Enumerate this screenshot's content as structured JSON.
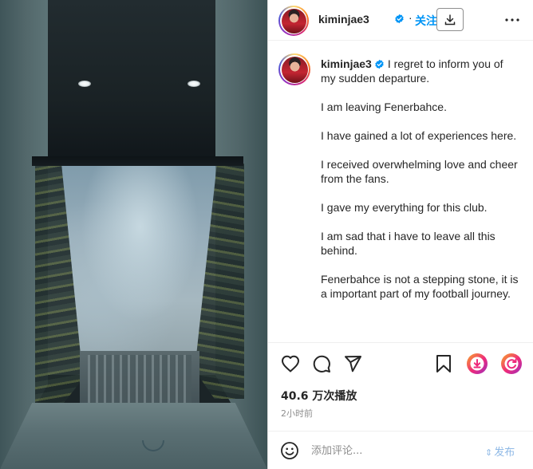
{
  "colors": {
    "accent": "#0095f6",
    "text": "#262626",
    "secondary_text": "#8e8e8e",
    "post_disabled": "#8fb9e6"
  },
  "header": {
    "username": "kiminjae3",
    "verified_icon": "verified-badge-icon",
    "separator": "·",
    "follow_label": "关注",
    "download_icon": "download-icon",
    "more_icon": "more-options-icon"
  },
  "caption": {
    "username": "kiminjae3",
    "paragraphs": [
      "I regret to inform you of my sudden departure.",
      "I am leaving Fenerbahce.",
      "I have gained a lot of experiences here.",
      "I received overwhelming love and cheer from the fans.",
      "I gave my everything for this club.",
      "I am sad that i have to leave all this behind.",
      "Fenerbahce is not a stepping stone, it is a important part of my football journey."
    ]
  },
  "actions": {
    "like_icon": "heart-icon",
    "comment_icon": "comment-icon",
    "share_icon": "share-icon",
    "save_icon": "bookmark-icon",
    "ext_download_icon": "download-extension-icon",
    "ext_repost_icon": "repost-extension-icon"
  },
  "stats": {
    "views": "40.6 万次播放",
    "time": "2小时前"
  },
  "comment": {
    "emoji_icon": "emoji-icon",
    "placeholder": "添加评论...",
    "post_label": "发布"
  }
}
